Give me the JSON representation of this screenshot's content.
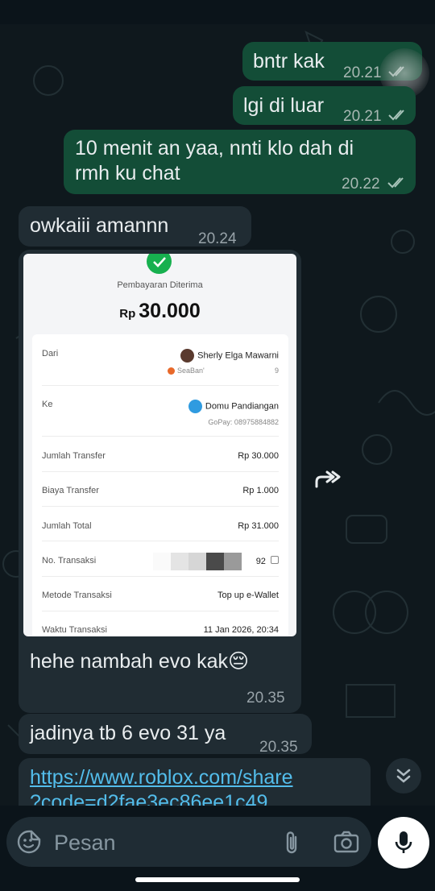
{
  "colors": {
    "outgoing": "#134d37",
    "incoming": "#202c33",
    "link": "#53bdeb",
    "bg": "#0b141a"
  },
  "messages": [
    {
      "text": "bntr kak",
      "time": "20.21",
      "direction": "out",
      "status": "read"
    },
    {
      "text": "lgi di luar",
      "time": "20.21",
      "direction": "out",
      "status": "read"
    },
    {
      "text": "10 menit an yaa, nnti klo dah di rmh ku chat",
      "line1": "10 menit an yaa, nnti klo dah di",
      "line2": "rmh ku chat",
      "time": "20.22",
      "direction": "out",
      "status": "read"
    },
    {
      "text": "owkaiii amannn",
      "time": "20.24",
      "direction": "in"
    },
    {
      "text": "hehe nambah evo kak😔",
      "time": "20.35",
      "direction": "in"
    },
    {
      "text": "jadinya tb 6 evo 31 ya",
      "time": "20.35",
      "direction": "in"
    },
    {
      "link_line1": "https://www.roblox.com/share",
      "link_line2": "?code=d2fae3ec86ee1c49",
      "direction": "in"
    }
  ],
  "receipt": {
    "title": "Pembayaran Diterima",
    "currency": "Rp",
    "amount": "30.000",
    "from_label": "Dari",
    "from_name": "Sherly Elga Mawarni",
    "from_sub": "SeaBan'",
    "from_sub_end": "9",
    "to_label": "Ke",
    "to_name": "Domu Pandiangan",
    "to_sub": "GoPay: 08975884882",
    "rows": [
      {
        "label": "Jumlah Transfer",
        "value": "Rp 30.000"
      },
      {
        "label": "Biaya Transfer",
        "value": "Rp 1.000"
      },
      {
        "label": "Jumlah Total",
        "value": "Rp 31.000"
      },
      {
        "label": "No. Transaksi",
        "value": "92"
      },
      {
        "label": "Metode Transaksi",
        "value": "Top up e-Wallet"
      },
      {
        "label": "Waktu Transaksi",
        "value": "11 Jan 2026, 20:34"
      }
    ]
  },
  "composer": {
    "placeholder": "Pesan"
  }
}
